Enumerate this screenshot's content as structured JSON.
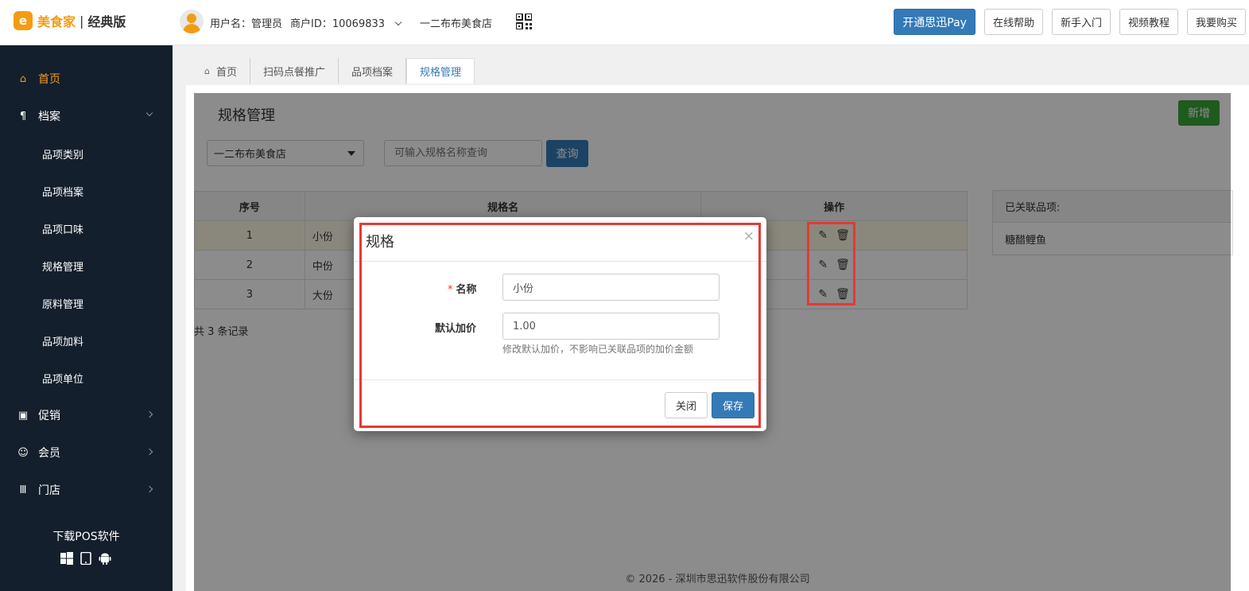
{
  "header": {
    "logo_mark": "e",
    "logo_name": "美食家",
    "logo_separator": "|",
    "logo_edition": "经典版",
    "username": "用户名：管理员",
    "merchant_id": "商户ID：10069833",
    "store_name": "一二布布美食店",
    "buttons": [
      "开通思迅Pay",
      "在线帮助",
      "新手入门",
      "视频教程",
      "我要购买"
    ]
  },
  "sidebar": {
    "items": [
      {
        "label": "首页",
        "icon": "home-icon",
        "glyph": "⌂"
      },
      {
        "label": "档案",
        "icon": "cutlery-icon",
        "glyph": "¶"
      },
      {
        "label": "促销",
        "icon": "gift-icon",
        "glyph": "▣"
      },
      {
        "label": "会员",
        "icon": "users-icon",
        "glyph": "☺"
      },
      {
        "label": "门店",
        "icon": "bank-icon",
        "glyph": "Ⅲ"
      }
    ],
    "subitems": [
      "品项类别",
      "品项档案",
      "品项口味",
      "规格管理",
      "原料管理",
      "品项加料",
      "品项单位"
    ],
    "pos_download": "下载POS软件"
  },
  "tabs": [
    "首页",
    "扫码点餐推广",
    "品项档案",
    "规格管理"
  ],
  "page": {
    "title": "规格管理",
    "new_button": "新增",
    "store_select": "一二布布美食店",
    "search_placeholder": "可输入规格名称查询",
    "query_button": "查询",
    "table": {
      "headers": [
        "序号",
        "规格名",
        "操作"
      ],
      "rows": [
        {
          "index": "1",
          "name": "小份"
        },
        {
          "index": "2",
          "name": "中份"
        },
        {
          "index": "3",
          "name": "大份"
        }
      ]
    },
    "total": "共 3 条记录",
    "linked_title": "已关联品项:",
    "linked_items": [
      "糖醋鲤鱼"
    ],
    "footer": "© 2026 - 深圳市思迅软件股份有限公司"
  },
  "modal": {
    "title": "规格",
    "close_x": "×",
    "required_mark": "*",
    "name_label": "名称",
    "name_value": "小份",
    "price_label": "默认加价",
    "price_value": "1.00",
    "help_text": "修改默认加价，不影响已关联品项的加价金额",
    "close_button": "关闭",
    "save_button": "保存"
  },
  "colors": {
    "accent": "#f39c12",
    "primary": "#337ab7",
    "success": "#3aa53a",
    "sidebar_bg": "#131f2c",
    "highlight_frame": "#e53935"
  }
}
